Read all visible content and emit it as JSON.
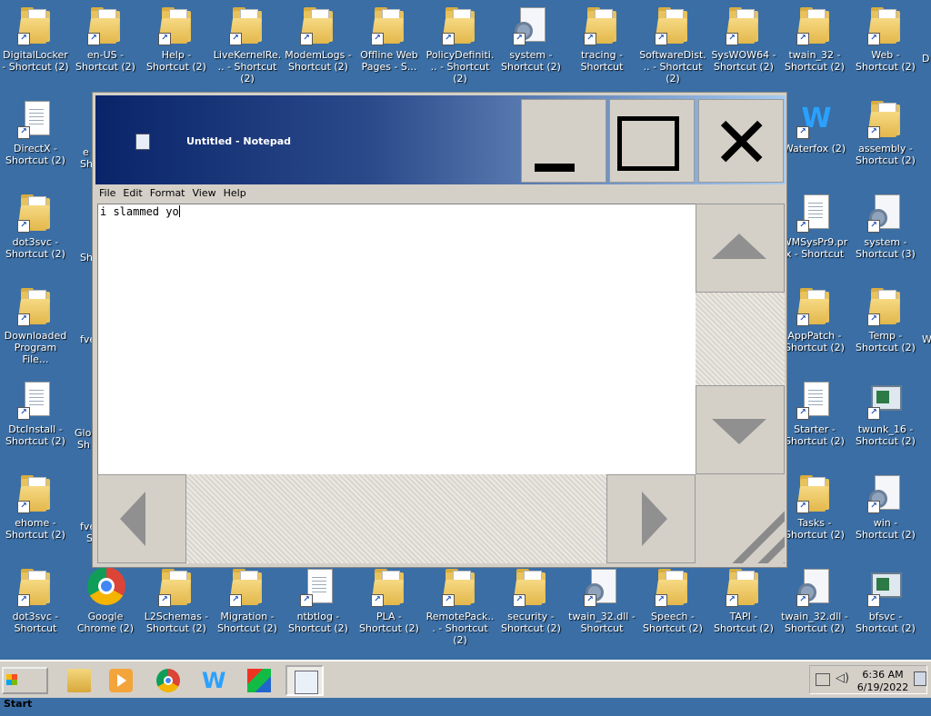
{
  "desktop": {
    "icons": [
      {
        "label": "DigitalLocker - Shortcut (2)",
        "kind": "folder"
      },
      {
        "label": "en-US - Shortcut (2)",
        "kind": "folder"
      },
      {
        "label": "Help - Shortcut (2)",
        "kind": "folder"
      },
      {
        "label": "LiveKernelRe... - Shortcut (2)",
        "kind": "folder"
      },
      {
        "label": "ModemLogs - Shortcut (2)",
        "kind": "folder"
      },
      {
        "label": "Offline Web Pages - S...",
        "kind": "folder"
      },
      {
        "label": "PolicyDefiniti... - Shortcut (2)",
        "kind": "folder"
      },
      {
        "label": "system - Shortcut (2)",
        "kind": "gear"
      },
      {
        "label": "tracing - Shortcut",
        "kind": "folder"
      },
      {
        "label": "SoftwareDist... - Shortcut (2)",
        "kind": "folder"
      },
      {
        "label": "SysWOW64 - Shortcut (2)",
        "kind": "folder"
      },
      {
        "label": "twain_32 - Shortcut (2)",
        "kind": "folder"
      },
      {
        "label": "Web - Shortcut (2)",
        "kind": "folder"
      },
      {
        "label": "DirectX - Shortcut (2)",
        "kind": "file"
      },
      {
        "label": "Waterfox (2)",
        "kind": "waterfox"
      },
      {
        "label": "assembly - Shortcut (2)",
        "kind": "folder"
      },
      {
        "label": "dot3svc - Shortcut (2)",
        "kind": "folder"
      },
      {
        "label": "WMSysPr9.prx - Shortcut",
        "kind": "file"
      },
      {
        "label": "system - Shortcut (3)",
        "kind": "gear"
      },
      {
        "label": "Downloaded Program File...",
        "kind": "folder"
      },
      {
        "label": "AppPatch - Shortcut (2)",
        "kind": "folder"
      },
      {
        "label": "Temp - Shortcut (2)",
        "kind": "folder"
      },
      {
        "label": "DtcInstall - Shortcut (2)",
        "kind": "file"
      },
      {
        "label": "Starter - Shortcut (2)",
        "kind": "file"
      },
      {
        "label": "twunk_16 - Shortcut (2)",
        "kind": "monitor"
      },
      {
        "label": "ehome - Shortcut (2)",
        "kind": "folder"
      },
      {
        "label": "Tasks - Shortcut (2)",
        "kind": "folder"
      },
      {
        "label": "win - Shortcut (2)",
        "kind": "gear"
      },
      {
        "label": "dot3svc - Shortcut",
        "kind": "folder"
      },
      {
        "label": "Google Chrome (2)",
        "kind": "chrome"
      },
      {
        "label": "L2Schemas - Shortcut (2)",
        "kind": "folder"
      },
      {
        "label": "Migration - Shortcut (2)",
        "kind": "folder"
      },
      {
        "label": "ntbtlog - Shortcut (2)",
        "kind": "file"
      },
      {
        "label": "PLA - Shortcut (2)",
        "kind": "folder"
      },
      {
        "label": "RemotePack... - Shortcut (2)",
        "kind": "folder"
      },
      {
        "label": "security - Shortcut (2)",
        "kind": "folder"
      },
      {
        "label": "twain_32.dll - Shortcut",
        "kind": "gear"
      },
      {
        "label": "Speech - Shortcut (2)",
        "kind": "folder"
      },
      {
        "label": "TAPI - Shortcut (2)",
        "kind": "folder"
      },
      {
        "label": "twain_32.dll - Shortcut (2)",
        "kind": "gear"
      },
      {
        "label": "bfsvc - Shortcut (2)",
        "kind": "monitor"
      }
    ],
    "partial_labels": [
      "e",
      "Sh",
      "Sh",
      "fve",
      "Glob",
      "Sh",
      "fve",
      "S",
      "D",
      "W"
    ]
  },
  "notepad": {
    "title": "Untitled - Notepad",
    "menu": [
      "File",
      "Edit",
      "Format",
      "View",
      "Help"
    ],
    "text": "i slammed yo"
  },
  "taskbar": {
    "start_label": "Start",
    "apps": [
      "file-explorer-icon",
      "media-player-icon",
      "chrome-icon",
      "waterfox-icon",
      "app-icon",
      "notepad-icon"
    ],
    "time": "6:36 AM",
    "date": "6/19/2022"
  }
}
